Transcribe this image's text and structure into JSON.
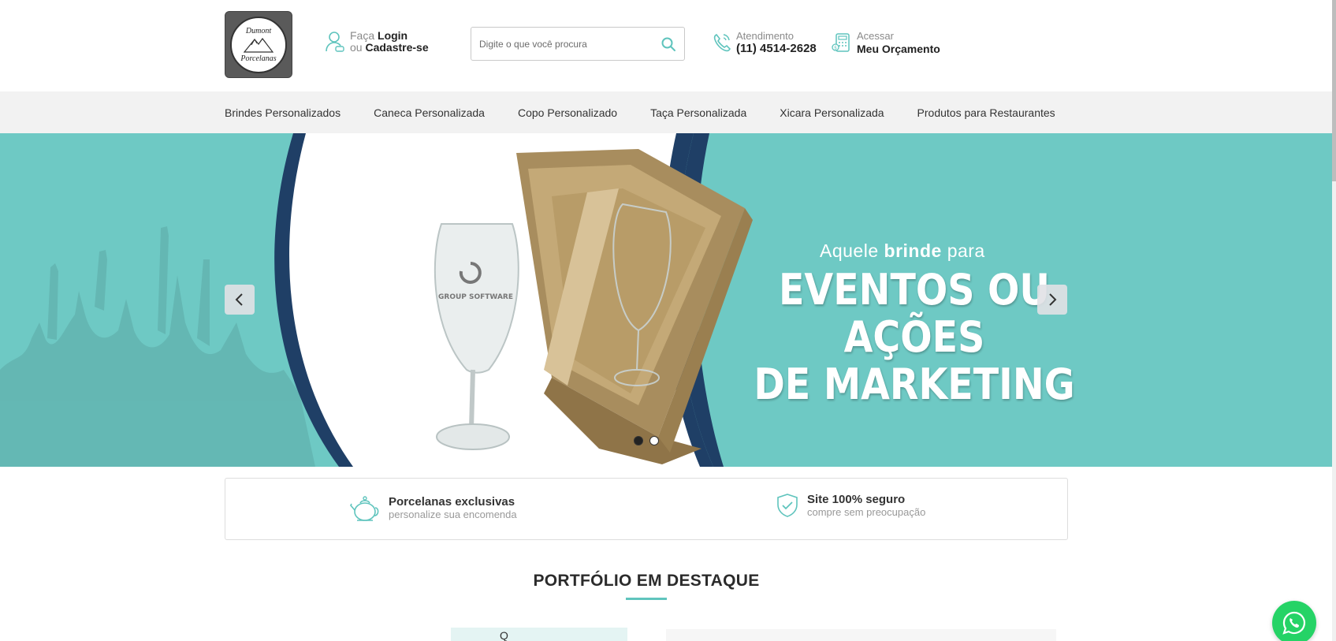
{
  "header": {
    "logo": {
      "line1": "Dumont",
      "line2": "Porcelanas"
    },
    "login": {
      "prefix": "Faça",
      "login_label": "Login",
      "or": "ou",
      "register_label": "Cadastre-se"
    },
    "search": {
      "placeholder": "Digite o que você procura",
      "value": ""
    },
    "support": {
      "label": "Atendimento",
      "phone": "(11) 4514-2628"
    },
    "quote": {
      "label": "Acessar",
      "link": "Meu Orçamento"
    }
  },
  "nav": {
    "items": [
      "Brindes Personalizados",
      "Caneca Personalizada",
      "Copo Personalizado",
      "Taça Personalizada",
      "Xicara Personalizada",
      "Produtos para Restaurantes"
    ]
  },
  "banner": {
    "tagline_pre": "Aquele",
    "tagline_bold": "brinde",
    "tagline_post": "para",
    "headline_line1": "EVENTOS OU AÇÕES",
    "headline_line2": "DE MARKETING",
    "glass_print": "GROUP SOFTWARE",
    "slides": 2,
    "active_slide": 1,
    "colors": {
      "teal": "#6ec9c4",
      "navy": "#1f3f66"
    }
  },
  "features": [
    {
      "icon": "teapot-icon",
      "title": "Porcelanas exclusivas",
      "subtitle": "personalize sua encomenda"
    },
    {
      "icon": "shield-check-icon",
      "title": "Site 100% seguro",
      "subtitle": "compre sem preocupação"
    }
  ],
  "portfolio": {
    "title": "PORTFÓLIO EM DESTAQUE",
    "thumb_text": "Q"
  },
  "colors": {
    "accent": "#5fc4bd",
    "whatsapp": "#25d366"
  }
}
